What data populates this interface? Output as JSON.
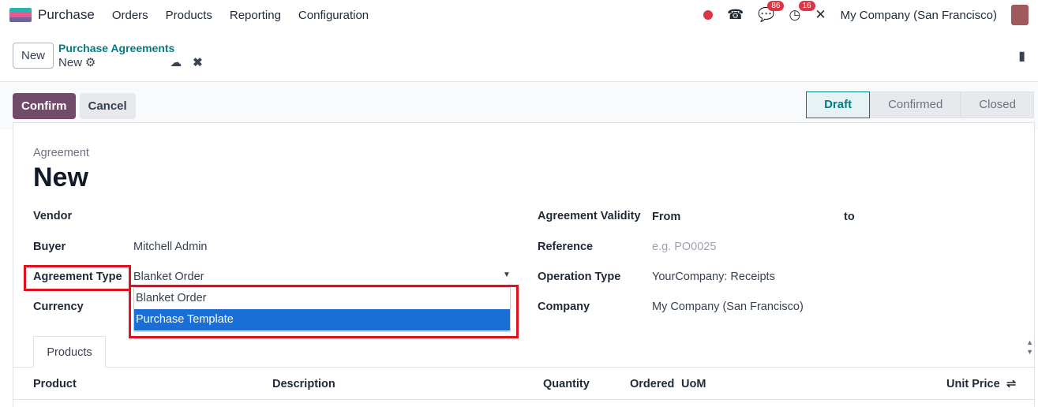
{
  "nav": {
    "app": "Purchase",
    "menus": [
      "Orders",
      "Products",
      "Reporting",
      "Configuration"
    ],
    "messages_count": "86",
    "activities_count": "16",
    "company": "My Company (San Francisco)"
  },
  "control": {
    "new_button": "New",
    "breadcrumb_parent": "Purchase Agreements",
    "breadcrumb_current": "New"
  },
  "actions": {
    "confirm": "Confirm",
    "cancel": "Cancel"
  },
  "statusbar": [
    "Draft",
    "Confirmed",
    "Closed"
  ],
  "form": {
    "title_label": "Agreement",
    "title": "New",
    "vendor_label": "Vendor",
    "buyer_label": "Buyer",
    "buyer": "Mitchell Admin",
    "agreement_type_label": "Agreement Type",
    "agreement_type": "Blanket Order",
    "currency_label": "Currency",
    "validity_label": "Agreement Validity",
    "from_label": "From",
    "to_label": "to",
    "reference_label": "Reference",
    "reference_placeholder": "e.g. PO0025",
    "operation_type_label": "Operation Type",
    "operation_type": "YourCompany: Receipts",
    "company_label": "Company",
    "company": "My Company (San Francisco)",
    "dropdown_options": [
      "Blanket Order",
      "Purchase Template"
    ]
  },
  "tabs": [
    "Products"
  ],
  "columns": [
    "Product",
    "Description",
    "Quantity",
    "Ordered",
    "UoM",
    "Unit Price"
  ]
}
